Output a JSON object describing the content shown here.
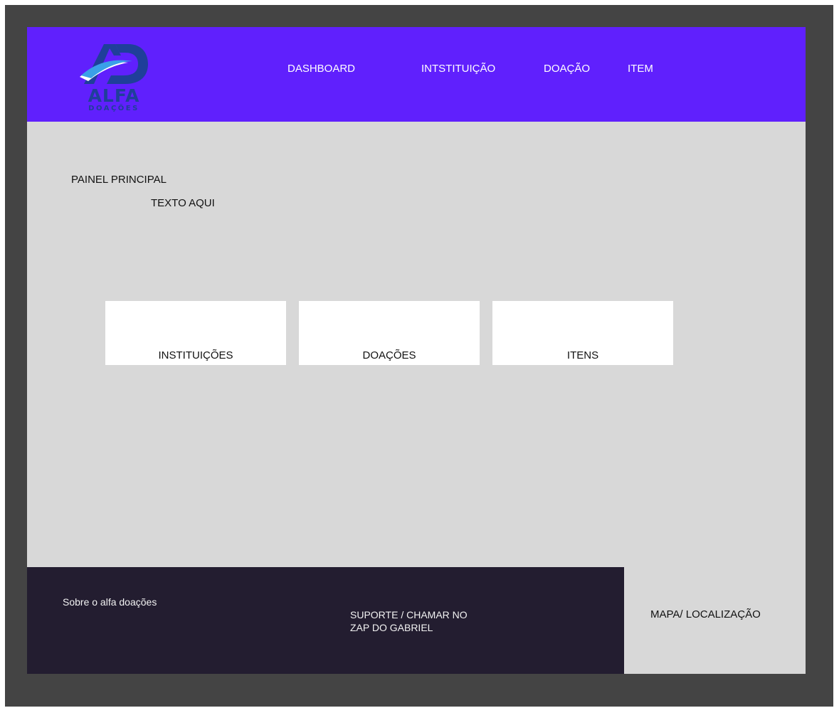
{
  "brand": {
    "name": "ALFA",
    "tagline": "DOAÇÕES",
    "colors": {
      "header_bg": "#6020fd",
      "logo_dark": "#1f3f9a",
      "page_bg": "#d8d8d8",
      "footer_bg": "#231d30",
      "outer_bg": "#444444"
    }
  },
  "nav": {
    "items": [
      {
        "label": "DASHBOARD"
      },
      {
        "label": "INTSTITUIÇÃO"
      },
      {
        "label": "DOAÇÃO"
      },
      {
        "label": "ITEM"
      }
    ]
  },
  "main": {
    "title": "PAINEL PRINCIPAL",
    "subtitle": "TEXTO AQUI",
    "cards": [
      {
        "label": "INSTITUIÇÕES"
      },
      {
        "label": "DOAÇÕES"
      },
      {
        "label": "ITENS"
      }
    ]
  },
  "footer": {
    "about": "Sobre o alfa doações",
    "support_line1": "SUPORTE / CHAMAR NO",
    "support_line2": "ZAP DO GABRIEL",
    "map": "MAPA/ LOCALIZAÇÃO"
  }
}
